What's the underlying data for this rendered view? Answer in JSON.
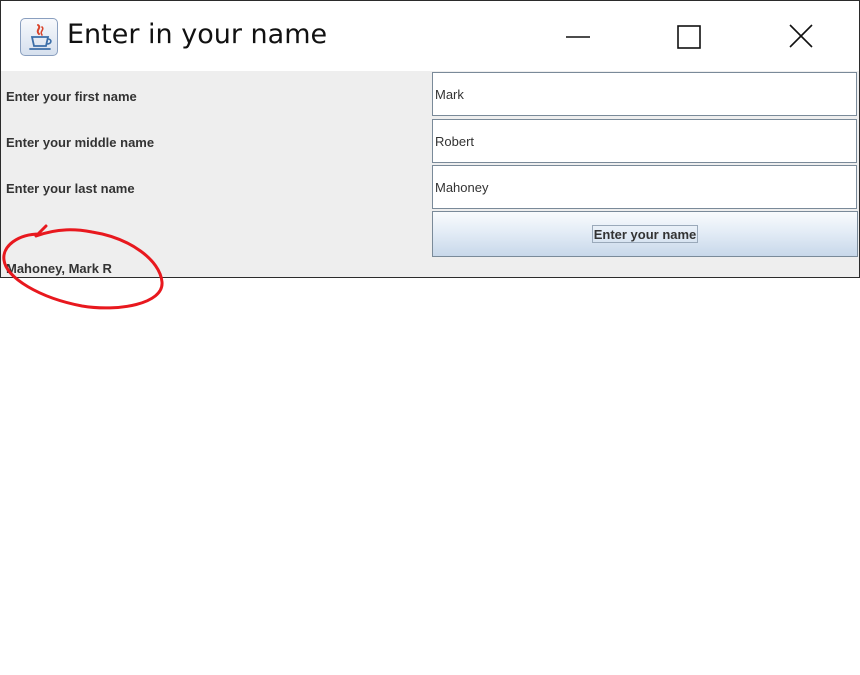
{
  "window": {
    "title": "Enter in your name",
    "icon": "java-coffee-cup-icon",
    "controls": {
      "minimize_icon": "minimize-icon",
      "maximize_icon": "maximize-icon",
      "close_icon": "close-icon"
    }
  },
  "form": {
    "first_name_label": "Enter your first name",
    "first_name_value": "Mark",
    "middle_name_label": "Enter your middle name",
    "middle_name_value": "Robert",
    "last_name_label": "Enter your last name",
    "last_name_value": "Mahoney",
    "submit_label": "Enter your name"
  },
  "output": {
    "result_text": "Mahoney, Mark R"
  },
  "colors": {
    "annotation": "#e8181e",
    "panel_background": "#eeeeee",
    "button_gradient_end": "#c8d8ea"
  }
}
